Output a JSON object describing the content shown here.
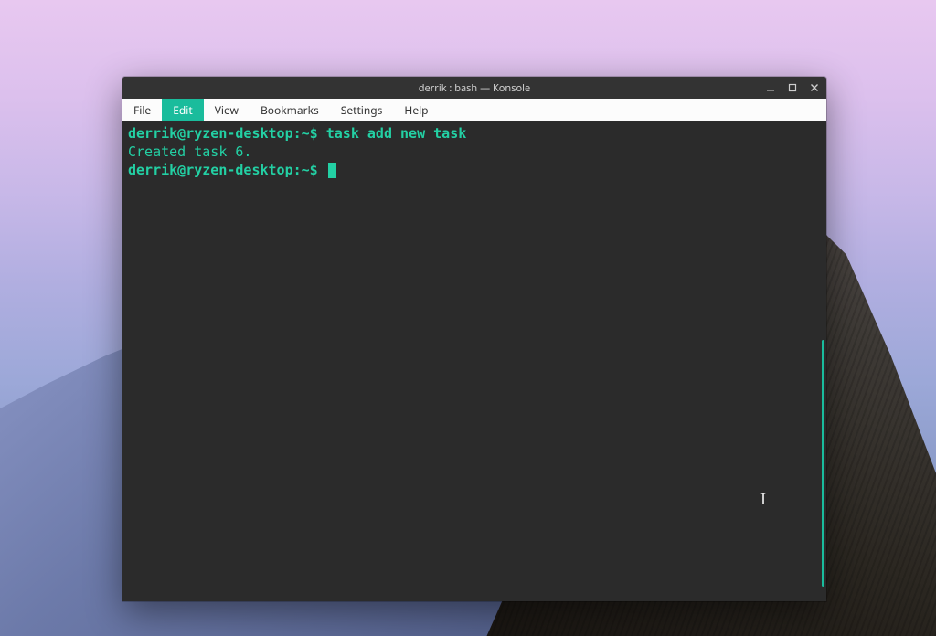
{
  "window": {
    "title": "derrik : bash — Konsole"
  },
  "menu": {
    "file": "File",
    "edit": "Edit",
    "view": "View",
    "bookmarks": "Bookmarks",
    "settings": "Settings",
    "help": "Help"
  },
  "terminal": {
    "prompt1_userhost": "derrik@ryzen-desktop",
    "prompt1_path": ":~$",
    "command1": " task add new task",
    "output1": "Created task 6.",
    "prompt2_userhost": "derrik@ryzen-desktop",
    "prompt2_path": ":~$"
  },
  "colors": {
    "accent": "#1abc9c",
    "term_bg": "#2b2b2b",
    "term_green": "#23d0a4"
  }
}
